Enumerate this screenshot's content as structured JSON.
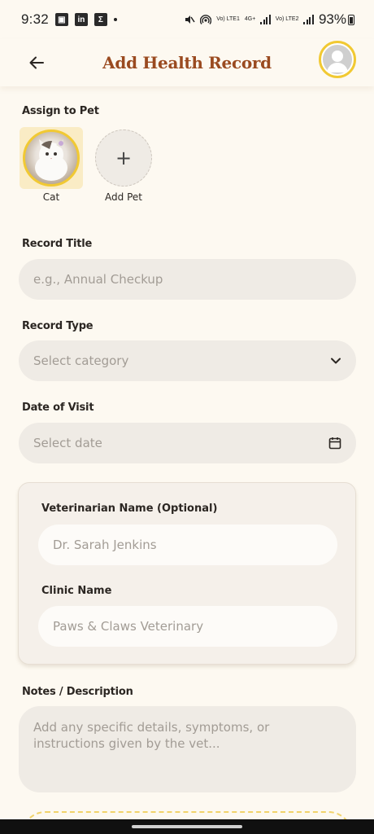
{
  "status_bar": {
    "time": "9:32",
    "net1": "Vo) LTE1",
    "net_4g": "4G+",
    "net2": "Vo) LTE2",
    "battery": "93%"
  },
  "header": {
    "title": "Add Health Record"
  },
  "assign_pet": {
    "label": "Assign to Pet",
    "pets": [
      {
        "name": "Cat",
        "selected": true
      }
    ],
    "add_label": "Add Pet"
  },
  "record_title": {
    "label": "Record Title",
    "placeholder": "e.g., Annual Checkup",
    "value": ""
  },
  "record_type": {
    "label": "Record Type",
    "placeholder": "Select category"
  },
  "date_of_visit": {
    "label": "Date of Visit",
    "placeholder": "Select date"
  },
  "vet_card": {
    "vet_label": "Veterinarian Name (Optional)",
    "vet_placeholder": "Dr. Sarah Jenkins",
    "clinic_label": "Clinic Name",
    "clinic_placeholder": "Paws & Claws Veterinary"
  },
  "notes": {
    "label": "Notes / Description",
    "placeholder": "Add any specific details, symptoms, or instructions given by the vet..."
  },
  "colors": {
    "background": "#fdf9f1",
    "title": "#9a4a20",
    "accent_yellow": "#f1c933",
    "field_bg": "#efebe5",
    "placeholder": "#a29c95"
  }
}
